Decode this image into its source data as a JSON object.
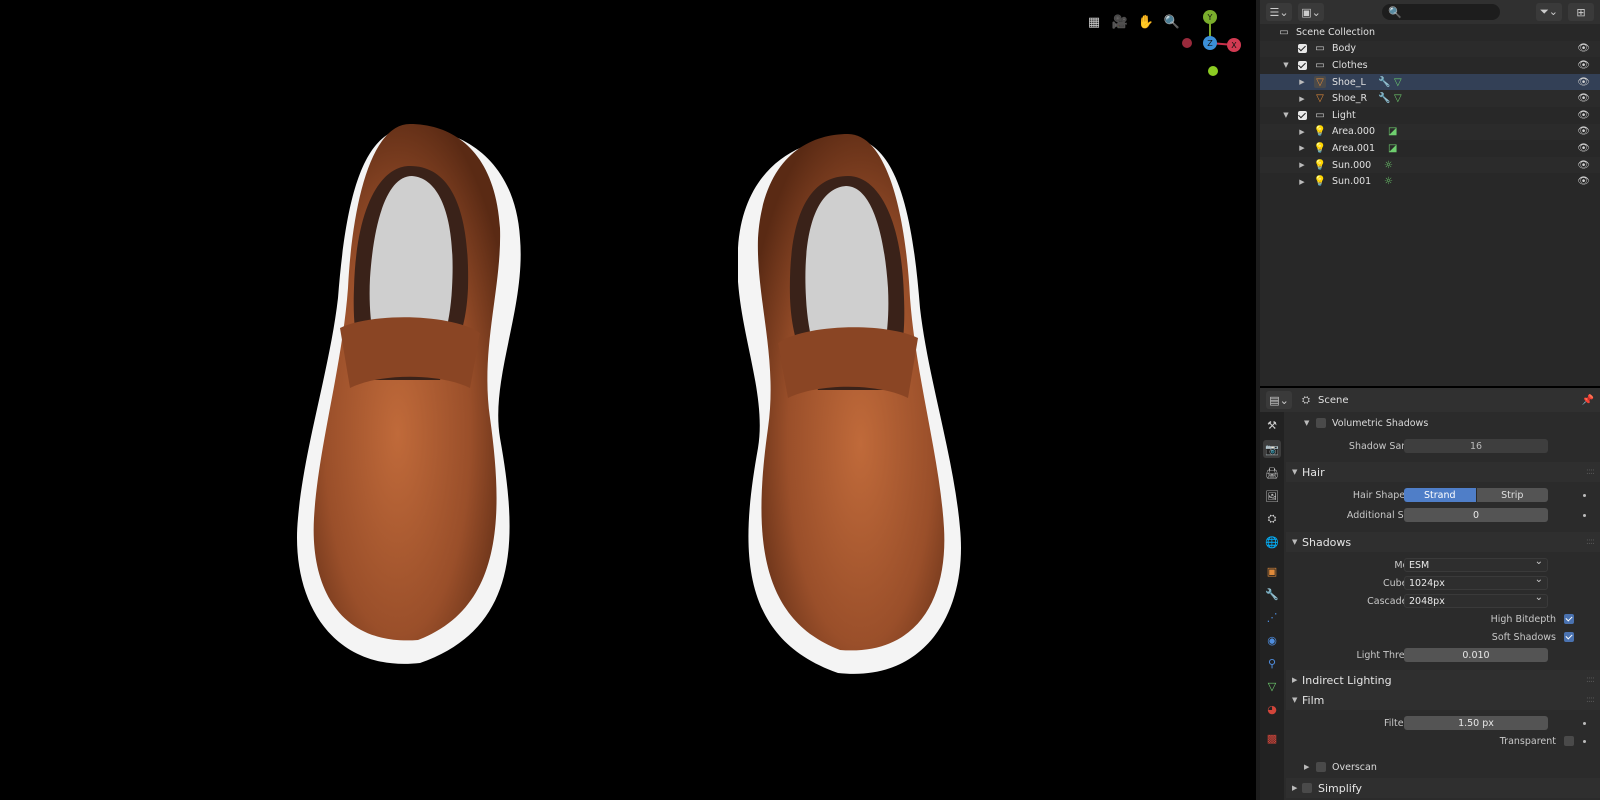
{
  "viewport": {
    "tool_icons": [
      "grid-icon",
      "camera-icon",
      "hand-icon",
      "zoom-icon"
    ],
    "gizmo": {
      "y": "Y",
      "z": "Z",
      "x": "X"
    }
  },
  "outliner": {
    "search": {
      "placeholder": "",
      "icon": "🔍"
    },
    "rows": [
      {
        "label": "Scene Collection",
        "type": "scene"
      },
      {
        "label": "Body",
        "type": "collection"
      },
      {
        "label": "Clothes",
        "type": "collection"
      },
      {
        "label": "Shoe_L",
        "type": "mesh"
      },
      {
        "label": "Shoe_R",
        "type": "mesh"
      },
      {
        "label": "Light",
        "type": "collection"
      },
      {
        "label": "Area.000",
        "type": "light"
      },
      {
        "label": "Area.001",
        "type": "light"
      },
      {
        "label": "Sun.000",
        "type": "light"
      },
      {
        "label": "Sun.001",
        "type": "light"
      }
    ]
  },
  "properties": {
    "title": "Scene",
    "volumetric_shadows": {
      "label": "Volumetric Shadows",
      "samples_label": "Shadow Samples",
      "samples": "16"
    },
    "hair": {
      "header": "Hair",
      "shape_type_label": "Hair Shape Type",
      "strand": "Strand",
      "strip": "Strip",
      "subdiv_label": "Additional Subdiv",
      "subdiv": "0"
    },
    "shadows": {
      "header": "Shadows",
      "method_label": "Method",
      "method": "ESM",
      "cube_label": "Cube Size",
      "cube": "1024px",
      "cascade_label": "Cascade Size",
      "cascade": "2048px",
      "bitdepth_label": "High Bitdepth",
      "soft_label": "Soft Shadows",
      "threshold_label": "Light Threshold",
      "threshold": "0.010"
    },
    "indirect": {
      "header": "Indirect Lighting"
    },
    "film": {
      "header": "Film",
      "filter_label": "Filter Size",
      "filter": "1.50 px",
      "transparent_label": "Transparent",
      "overscan_label": "Overscan"
    },
    "simplify": {
      "header": "Simplify"
    }
  },
  "colors": {
    "selection": "#4f7ec8",
    "leather": "#9a4f2a",
    "sole": "#f2f2f2"
  }
}
